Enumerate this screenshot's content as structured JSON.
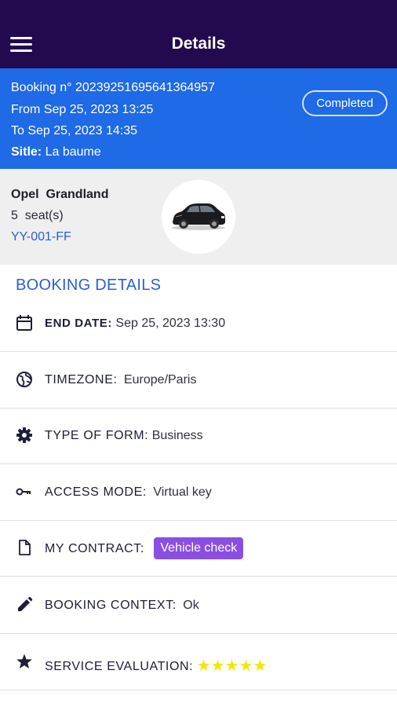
{
  "header": {
    "title": "Details",
    "menu_icon": "hamburger-menu-icon"
  },
  "booking": {
    "number_line": "Booking n° 20239251695641364957",
    "from_line": "From Sep 25, 2023 13:25",
    "to_line": "To Sep 25, 2023 14:35",
    "site_label": "Sitle:",
    "site_value": "La baume",
    "status": "Completed"
  },
  "vehicle": {
    "name": "Opel  Grandland",
    "seats": "5  seat(s)",
    "plate": "YY-001-FF",
    "image_icon": "car-icon"
  },
  "details": {
    "section_title": "BOOKING DETAILS",
    "end_date": {
      "label": "END DATE:",
      "value": "Sep 25, 2023 13:30",
      "icon": "calendar-icon"
    },
    "timezone": {
      "label": "TIMEZONE:",
      "value": "Europe/Paris",
      "icon": "globe-icon"
    },
    "type_of_form": {
      "label": "TYPE OF FORM:",
      "value": "Business",
      "icon": "gear-icon"
    },
    "access_mode": {
      "label": "ACCESS MODE:",
      "value": "Virtual key",
      "icon": "key-icon"
    },
    "contract": {
      "label": "MY CONTRACT:",
      "badge": "Vehicle check",
      "icon": "document-icon"
    },
    "booking_context": {
      "label": "BOOKING CONTEXT:",
      "value": "Ok",
      "icon": "pencil-icon"
    },
    "service_evaluation": {
      "label": "SERVICE EVALUATION:",
      "stars": "★★★★★",
      "rating": 5,
      "max_rating": 5,
      "icon": "star-icon"
    }
  },
  "colors": {
    "appbar": "#230a4f",
    "banner": "#1f6ae6",
    "accent": "#2b5fd8",
    "badge": "#8a4fe0",
    "stars": "#f1e700"
  }
}
